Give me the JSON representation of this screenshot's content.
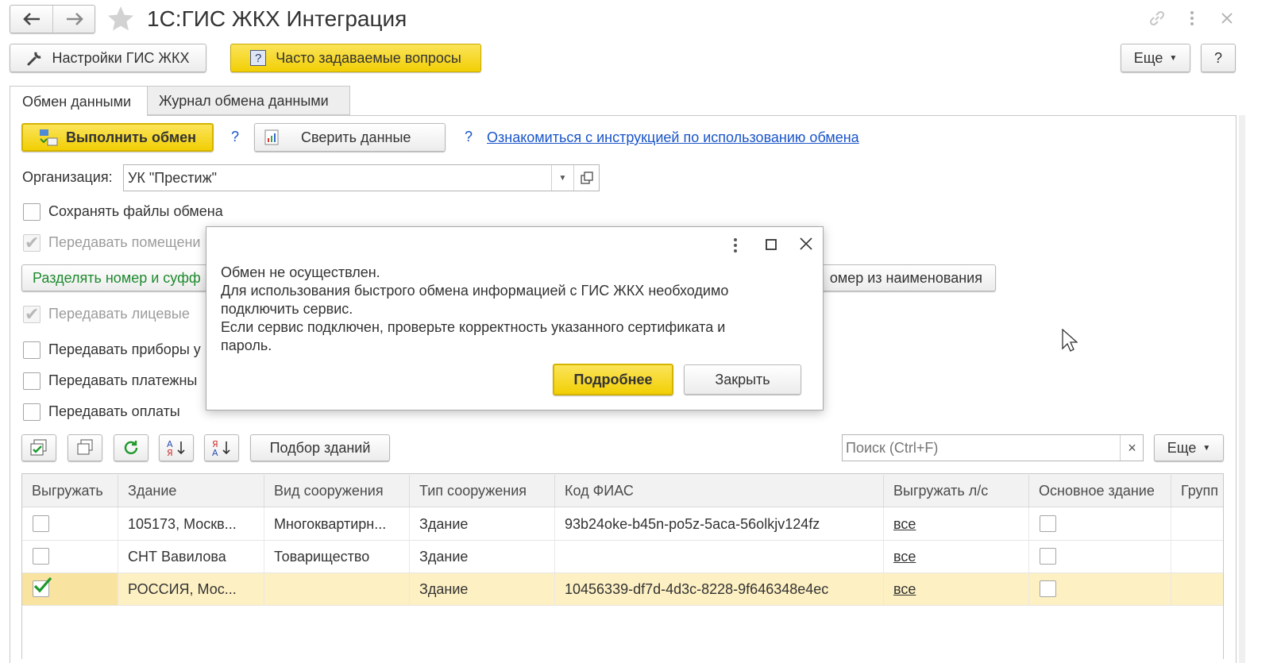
{
  "window": {
    "title": "1С:ГИС ЖКХ Интеграция"
  },
  "toolbar": {
    "settings_label": "Настройки ГИС ЖКХ",
    "faq_label": "Часто задаваемые вопросы",
    "more_label": "Еще",
    "help_label": "?"
  },
  "tabs": [
    {
      "label": "Обмен данными",
      "active": true
    },
    {
      "label": "Журнал обмена данными",
      "active": false
    }
  ],
  "actions": {
    "exchange_label": "Выполнить обмен",
    "q1": "?",
    "verify_label": "Сверить данные",
    "q2": "?",
    "instruction_link": "Ознакомиться с инструкцией по использованию обмена"
  },
  "organization": {
    "label": "Организация:",
    "value": "УК \"Престиж\""
  },
  "options": {
    "save_files": "Сохранять файлы обмена",
    "transfer_rooms": "Передавать помещени",
    "split_button": "Разделять номер и суфф",
    "number_from_name": "омер из наименования",
    "transfer_accounts": "Передавать лицевые",
    "transfer_devices": "Передавать приборы у",
    "transfer_payments_docs": "Передавать платежны",
    "transfer_payments": "Передавать оплаты"
  },
  "list_toolbar": {
    "select_buildings": "Подбор зданий",
    "search_placeholder": "Поиск (Ctrl+F)",
    "clear": "×",
    "more_label": "Еще"
  },
  "table": {
    "columns": [
      "Выгружать",
      "Здание",
      "Вид сооружения",
      "Тип сооружения",
      "Код ФИАС",
      "Выгружать л/с",
      "Основное здание",
      "Групп"
    ],
    "rows": [
      {
        "export": false,
        "building": "105173, Москв...",
        "kind": "Многоквартирн...",
        "type": "Здание",
        "fias": "93b24oke-b45n-po5z-5aca-56olkjv124fz",
        "accounts": "все",
        "main": false,
        "selected": false
      },
      {
        "export": false,
        "building": "СНТ Вавилова",
        "kind": "Товарищество",
        "type": "Здание",
        "fias": "",
        "accounts": "все",
        "main": false,
        "selected": false
      },
      {
        "export": true,
        "building": "РОССИЯ, Мос...",
        "kind": "",
        "type": "Здание",
        "fias": "10456339-df7d-4d3c-8228-9f646348e4ec",
        "accounts": "все",
        "main": false,
        "selected": true
      }
    ]
  },
  "dialog": {
    "line1": "Обмен не осуществлен.",
    "line2": "Для использования быстрого обмена информацией с ГИС ЖКХ необходимо",
    "line3": "подключить сервис.",
    "line4": "Если сервис подключен, проверьте корректность указанного сертификата и",
    "line5": "пароль.",
    "details_label": "Подробнее",
    "close_label": "Закрыть"
  },
  "colors": {
    "accent_yellow": "#f2cf05",
    "link_blue": "#1a55c8",
    "selected_row": "#fdf0c3",
    "green_text": "#1e8a2e"
  }
}
